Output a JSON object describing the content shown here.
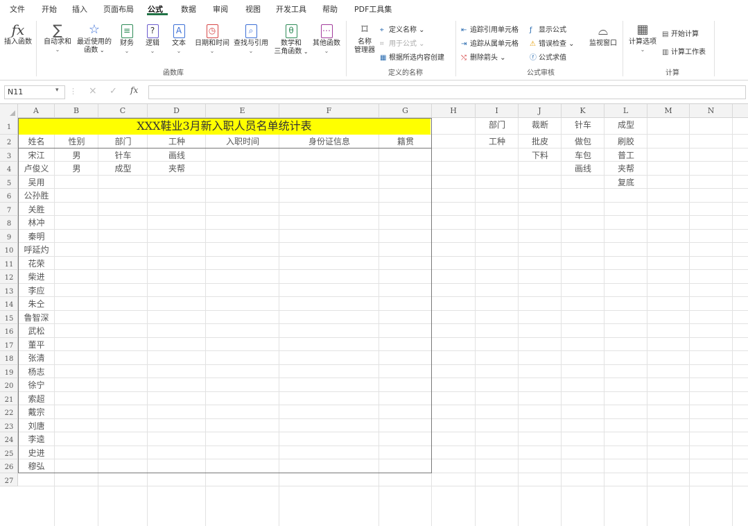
{
  "tabs": [
    "文件",
    "开始",
    "插入",
    "页面布局",
    "公式",
    "数据",
    "审阅",
    "视图",
    "开发工具",
    "帮助",
    "PDF工具集"
  ],
  "active_tab": "公式",
  "ribbon": {
    "insert_function": "插入函数",
    "autosum": "自动求和",
    "recent_line1": "最近使用的",
    "recent_line2": "函数",
    "financial": "财务",
    "logical": "逻辑",
    "text": "文本",
    "datetime": "日期和时间",
    "lookup": "查找与引用",
    "math_line1": "数学和",
    "math_line2": "三角函数",
    "more": "其他函数",
    "library_group": "函数库",
    "name_mgr_line1": "名称",
    "name_mgr_line2": "管理器",
    "define_name": "定义名称",
    "use_in_formula": "用于公式",
    "create_from_sel": "根据所选内容创建",
    "defined_names_group": "定义的名称",
    "trace_precedents": "追踪引用单元格",
    "trace_dependents": "追踪从属单元格",
    "remove_arrows": "删除箭头",
    "show_formulas": "显示公式",
    "error_checking": "错误检查",
    "evaluate_formula": "公式求值",
    "audit_group": "公式审核",
    "watch_window": "监视窗口",
    "calc_options": "计算选项",
    "calc_now": "开始计算",
    "calc_sheet": "计算工作表",
    "calc_group": "计算"
  },
  "formula_bar": {
    "name_box": "N11",
    "fx": "fx",
    "formula": ""
  },
  "columns": [
    "A",
    "B",
    "C",
    "D",
    "E",
    "F",
    "G",
    "H",
    "I",
    "J",
    "K",
    "L",
    "M",
    "N"
  ],
  "rows": [
    "1",
    "2",
    "3",
    "4",
    "5",
    "6",
    "7",
    "8",
    "9",
    "10",
    "11",
    "12",
    "13",
    "14",
    "15",
    "16",
    "17",
    "18",
    "19",
    "20",
    "21",
    "22",
    "23",
    "24",
    "25",
    "26",
    "27"
  ],
  "sheet": {
    "title": "XXX鞋业3月新入职人员名单统计表",
    "headers": [
      "姓名",
      "性别",
      "部门",
      "工种",
      "入职时间",
      "身份证信息",
      "籍贯"
    ],
    "records": [
      [
        "宋江",
        "男",
        "针车",
        "画线"
      ],
      [
        "卢俊义",
        "男",
        "成型",
        "夹帮"
      ]
    ],
    "names_rest": [
      "吴用",
      "公孙胜",
      "关胜",
      "林冲",
      "秦明",
      "呼延灼",
      "花荣",
      "柴进",
      "李应",
      "朱仝",
      "鲁智深",
      "武松",
      "董平",
      "张清",
      "杨志",
      "徐宁",
      "索超",
      "戴宗",
      "刘唐",
      "李逵",
      "史进",
      "穆弘"
    ],
    "lookup": {
      "I1": "部门",
      "J1": "裁断",
      "K1": "针车",
      "L1": "成型",
      "I2": "工种",
      "J2": "批皮",
      "K2": "做包",
      "L2": "刷胶",
      "J3": "下料",
      "K3": "车包",
      "L3": "普工",
      "K4": "画线",
      "L4": "夹帮",
      "L5": "复底"
    }
  }
}
